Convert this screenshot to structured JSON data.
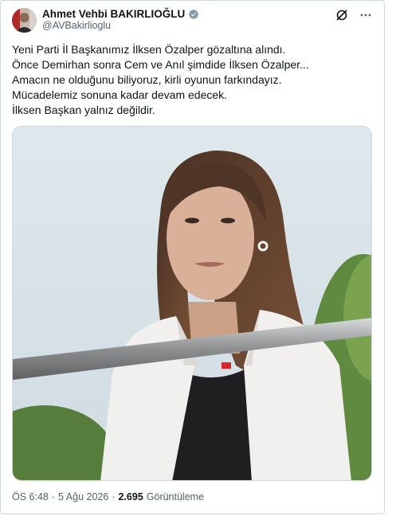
{
  "author": {
    "display_name": "Ahmet Vehbi BAKIRLIOĞLU",
    "handle": "@AVBakirlioglu",
    "verified": true
  },
  "header_icons": [
    "grok-icon",
    "more-icon"
  ],
  "tweet": {
    "lines": [
      "Yeni Parti İl Başkanımız İlksen Özalper gözaltına alındı.",
      "Önce Demirhan sonra Cem ve Anıl şimdide İlksen Özalper...",
      "Amacın ne olduğunu biliyoruz, kirli oyunun farkındayız.",
      "Mücadelemiz sonuna kadar devam edecek.",
      "İlksen Başkan yalnız değildir."
    ]
  },
  "meta": {
    "time": "ÖS 6:48",
    "separator": "·",
    "date": "5 Ağu 2026",
    "views_count": "2.695",
    "views_label": "Görüntüleme"
  },
  "colors": {
    "text_primary": "#0f1419",
    "text_secondary": "#536471",
    "border": "#cfd9de",
    "verified_badge": "#829aab"
  }
}
